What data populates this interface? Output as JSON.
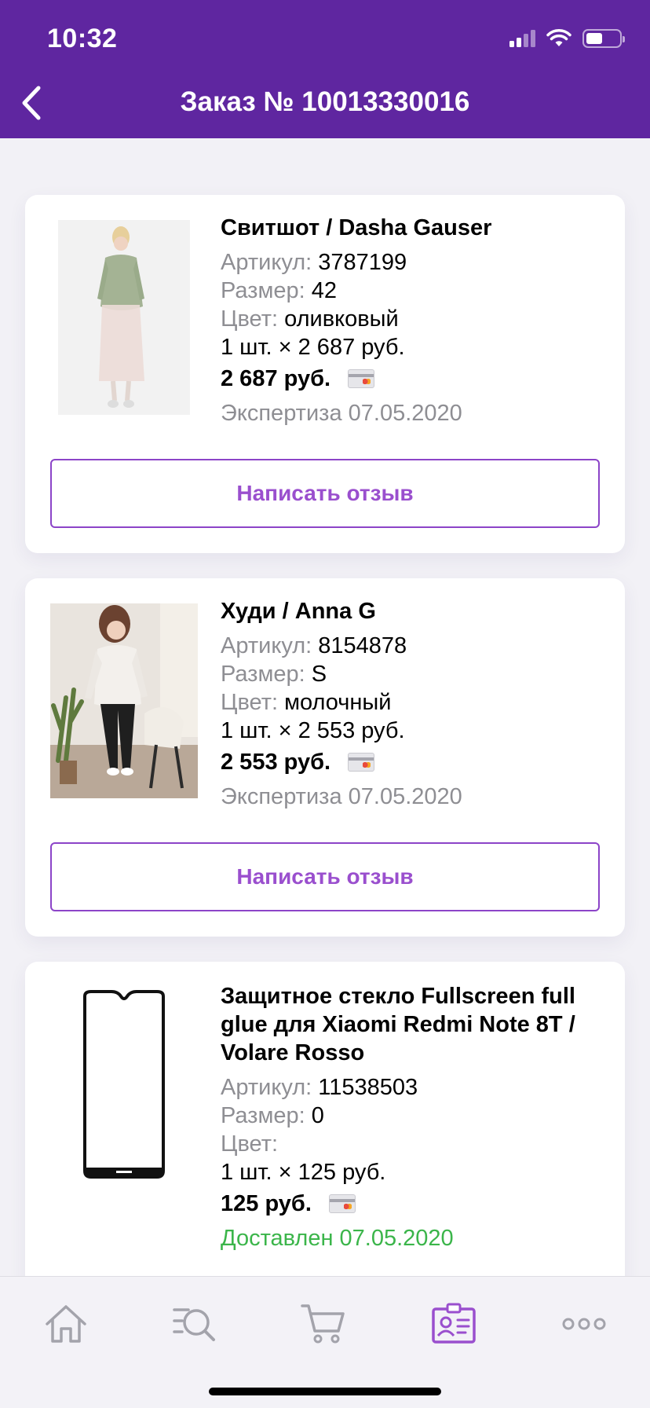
{
  "status_bar": {
    "time": "10:32"
  },
  "header": {
    "title": "Заказ № 10013330016"
  },
  "labels": {
    "article": "Артикул:",
    "size": "Размер:",
    "color": "Цвет:",
    "review_button": "Написать отзыв"
  },
  "items": [
    {
      "title": "Свитшот / Dasha Gauser",
      "article": "3787199",
      "size": "42",
      "color": "оливковый",
      "quantity_line": "1 шт. × 2 687 руб.",
      "price": "2 687 руб.",
      "status": "Экспертиза 07.05.2020"
    },
    {
      "title": "Худи / Anna G",
      "article": "8154878",
      "size": "S",
      "color": "молочный",
      "quantity_line": "1 шт. × 2 553 руб.",
      "price": "2 553 руб.",
      "status": "Экспертиза 07.05.2020"
    },
    {
      "title": "Защитное стекло Fullscreen full glue для Xiaomi Redmi Note 8T / Volare Rosso",
      "article": "11538503",
      "size": "0",
      "color": "",
      "quantity_line": "1 шт. × 125 руб.",
      "price": "125 руб.",
      "status": "Доставлен 07.05.2020"
    }
  ],
  "tabbar": {
    "tabs": [
      {
        "icon": "home-icon",
        "active": false
      },
      {
        "icon": "search-icon",
        "active": false
      },
      {
        "icon": "cart-icon",
        "active": false
      },
      {
        "icon": "profile-icon",
        "active": true
      },
      {
        "icon": "more-icon",
        "active": false
      }
    ]
  },
  "colors": {
    "brand": "#5f26a0",
    "accent": "#9a4fce",
    "delivered": "#3bb54a",
    "muted": "#8e8e93"
  }
}
